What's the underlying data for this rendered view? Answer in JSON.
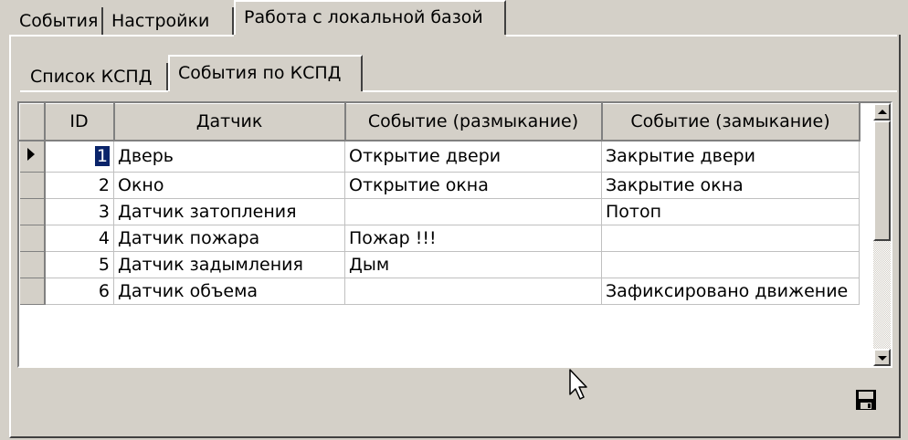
{
  "top_tabs": [
    {
      "label": "События"
    },
    {
      "label": "Настройки"
    },
    {
      "label": "Работа с локальной базой"
    }
  ],
  "sub_tabs": [
    {
      "label": "Список КСПД"
    },
    {
      "label": "События по КСПД"
    }
  ],
  "table": {
    "columns": [
      "ID",
      "Датчик",
      "Событие (размыкание)",
      "Событие (замыкание)"
    ],
    "rows": [
      {
        "id": "1",
        "sensor": "Дверь",
        "open_event": "Открытие двери",
        "close_event": "Закрытие двери"
      },
      {
        "id": "2",
        "sensor": "Окно",
        "open_event": "Открытие окна",
        "close_event": "Закрытие окна"
      },
      {
        "id": "3",
        "sensor": "Датчик затопления",
        "open_event": "",
        "close_event": "Потоп"
      },
      {
        "id": "4",
        "sensor": "Датчик пожара",
        "open_event": "Пожар !!!",
        "close_event": ""
      },
      {
        "id": "5",
        "sensor": "Датчик задымления",
        "open_event": "Дым",
        "close_event": ""
      },
      {
        "id": "6",
        "sensor": "Датчик объема",
        "open_event": "",
        "close_event": "Зафиксировано движение"
      }
    ],
    "selected_row": 1
  },
  "icons": {
    "row_indicator": "record-pointer-icon",
    "save": "floppy-disk-icon",
    "cursor": "mouse-pointer-icon",
    "scroll_up": "arrow-up-icon",
    "scroll_down": "arrow-down-icon"
  },
  "colors": {
    "face": "#d4d0c8",
    "selection": "#0a246a",
    "grid_bg": "#ffffff"
  }
}
